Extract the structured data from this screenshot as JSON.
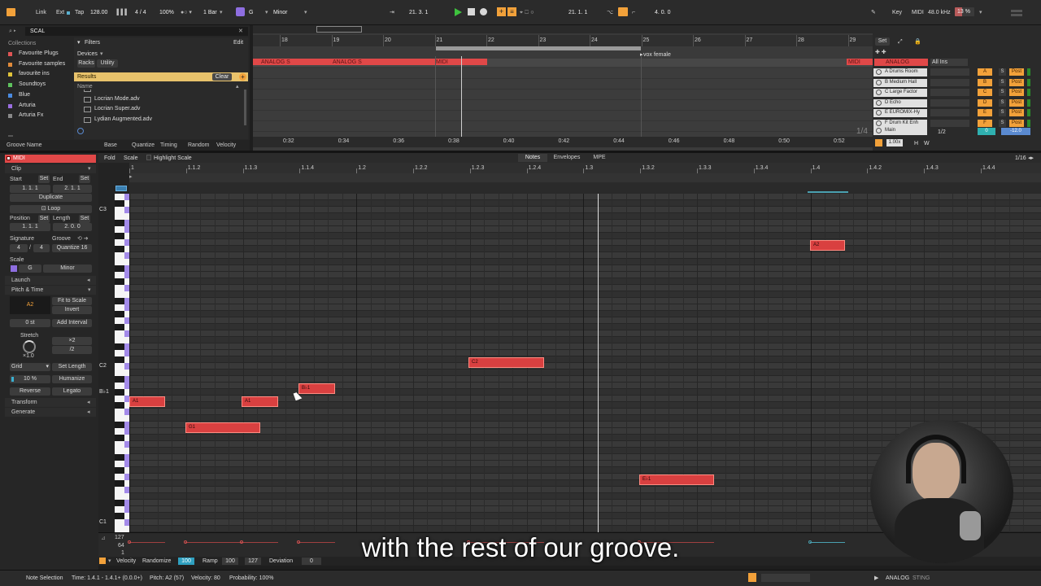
{
  "transport": {
    "link": "Link",
    "ext": "Ext",
    "tap": "Tap",
    "tempo": "128.00",
    "signature": "4 / 4",
    "zoom": "100%",
    "quantize": "1 Bar",
    "key_root": "G",
    "key_scale": "Minor",
    "position": "21.  3.  1",
    "loop_start": "21.  1.  1",
    "loop_length": "4.  0.  0",
    "key_label": "Key",
    "midi_label": "MIDI",
    "sample_rate": "48.0 kHz",
    "cpu": "13 %"
  },
  "browser": {
    "search": "SCAL",
    "collections_label": "Collections",
    "collections": [
      {
        "label": "Favourite Plugs",
        "color": "#e05555"
      },
      {
        "label": "Favourite samples",
        "color": "#e08a3a"
      },
      {
        "label": "favourite ins",
        "color": "#e0c33a"
      },
      {
        "label": "Soundtoys",
        "color": "#5ec25e"
      },
      {
        "label": "Blue",
        "color": "#4a8ae0"
      },
      {
        "label": "Arturia",
        "color": "#9a6ee0"
      },
      {
        "label": "Arturia Fx",
        "color": "#888888"
      }
    ],
    "filters_label": "Filters",
    "edit_label": "Edit",
    "devices_label": "Devices",
    "racks_label": "Racks",
    "utility_label": "Utility",
    "results_label": "Results",
    "clear_label": "Clear",
    "name_col": "Name",
    "results": [
      "Lombian",
      "Locrian Mode.adv",
      "Locrian Super.adv",
      "Lydian Augmented.adv"
    ]
  },
  "groove_bar": {
    "name": "Groove Name",
    "base": "Base",
    "quantize": "Quantize",
    "timing": "Timing",
    "random": "Random",
    "velocity": "Velocity"
  },
  "arrangement": {
    "bars": [
      "18",
      "19",
      "20",
      "21",
      "22",
      "23",
      "24",
      "25",
      "26",
      "27",
      "28",
      "29"
    ],
    "times": [
      "0:32",
      "0:34",
      "0:36",
      "0:38",
      "0:40",
      "0:42",
      "0:44",
      "0:46",
      "0:48",
      "0:50",
      "0:52"
    ],
    "clip_label_1": "ANALOG S",
    "clip_label_2": "ANALOG S",
    "clip_label_3": "MIDI",
    "locator": "vox female",
    "clip_label_4": "MIDI",
    "fraction": "1/4",
    "set_label": "Set"
  },
  "mixer": {
    "tracks": [
      {
        "name": "A Drums Room",
        "letter": "A"
      },
      {
        "name": "B Medium Hall",
        "letter": "B"
      },
      {
        "name": "C Large Factor",
        "letter": "C"
      },
      {
        "name": "D Echo",
        "letter": "D"
      },
      {
        "name": "E EUROMIX-Hy",
        "letter": "E"
      },
      {
        "name": "F Drum Kit Enh",
        "letter": "F"
      }
    ],
    "main_label": "Main",
    "main_ratio": "1/2",
    "main_val": "0",
    "main_db": "-12.0",
    "analog_header": "ANALOG",
    "all_ins": "All Ins",
    "s_label": "S",
    "post_label": "Post",
    "speed": "1.00x",
    "h_label": "H",
    "w_label": "W"
  },
  "clip_panel": {
    "title": "MIDI",
    "clip_section": "Clip",
    "start_label": "Start",
    "end_label": "End",
    "set": "Set",
    "start_val": "1.  1.  1",
    "end_val": "2.  1.  1",
    "duplicate": "Duplicate",
    "loop": "Loop",
    "position_label": "Position",
    "length_label": "Length",
    "position_val": "1.  1.  1",
    "length_val": "2.  0.  0",
    "signature_label": "Signature",
    "groove_label": "Groove",
    "sig_num": "4",
    "sig_den": "4",
    "groove_val": "Quantize 16",
    "scale_label": "Scale",
    "scale_root": "G",
    "scale_name": "Minor",
    "launch_section": "Launch",
    "pitch_section": "Pitch & Time",
    "pitch_val": "A2",
    "fit_to_scale": "Fit to Scale",
    "invert": "Invert",
    "semitones": "0 st",
    "add_interval": "Add Interval",
    "stretch_label": "Stretch",
    "stretch_val": "×1.0",
    "times2": "×2",
    "div2": "/2",
    "grid": "Grid",
    "set_length": "Set Length",
    "grid_pct": "10 %",
    "humanize": "Humanize",
    "reverse": "Reverse",
    "legato": "Legato",
    "transform_section": "Transform",
    "generate_section": "Generate"
  },
  "editor": {
    "fold": "Fold",
    "scale": "Scale",
    "highlight_scale": "Highlight Scale",
    "tabs": [
      "Notes",
      "Envelopes",
      "MPE"
    ],
    "grid_frac": "1/16",
    "ruler": [
      "1",
      "1.1.2",
      "1.1.3",
      "1.1.4",
      "1.2",
      "1.2.2",
      "1.2.3",
      "1.2.4",
      "1.3",
      "1.3.2",
      "1.3.3",
      "1.3.4",
      "1.4",
      "1.4.2",
      "1.4.3",
      "1.4.4"
    ],
    "pitch_labels": {
      "c3": "C3",
      "c2": "C2",
      "bb1": "B♭1",
      "c1": "C1"
    },
    "notes": [
      "A1",
      "G1",
      "A1",
      "B♭1",
      "C2",
      "E♭1",
      "A2"
    ]
  },
  "velocity_lane": {
    "max": "127",
    "mid": "64",
    "min": "1",
    "label": "Velocity",
    "randomize": "Randomize",
    "rand_val": "100",
    "ramp": "Ramp",
    "ramp_from": "100",
    "ramp_to": "127",
    "deviation": "Deviation",
    "dev_val": "0"
  },
  "caption": "with the rest of our groove.",
  "status": {
    "selection": "Note Selection",
    "time": "Time: 1.4.1 - 1.4.1+ (0.0.0+)",
    "pitch": "Pitch: A2 (57)",
    "velocity": "Velocity: 80",
    "probability": "Probability: 100%",
    "track": "ANALOG",
    "track2": "STING"
  }
}
